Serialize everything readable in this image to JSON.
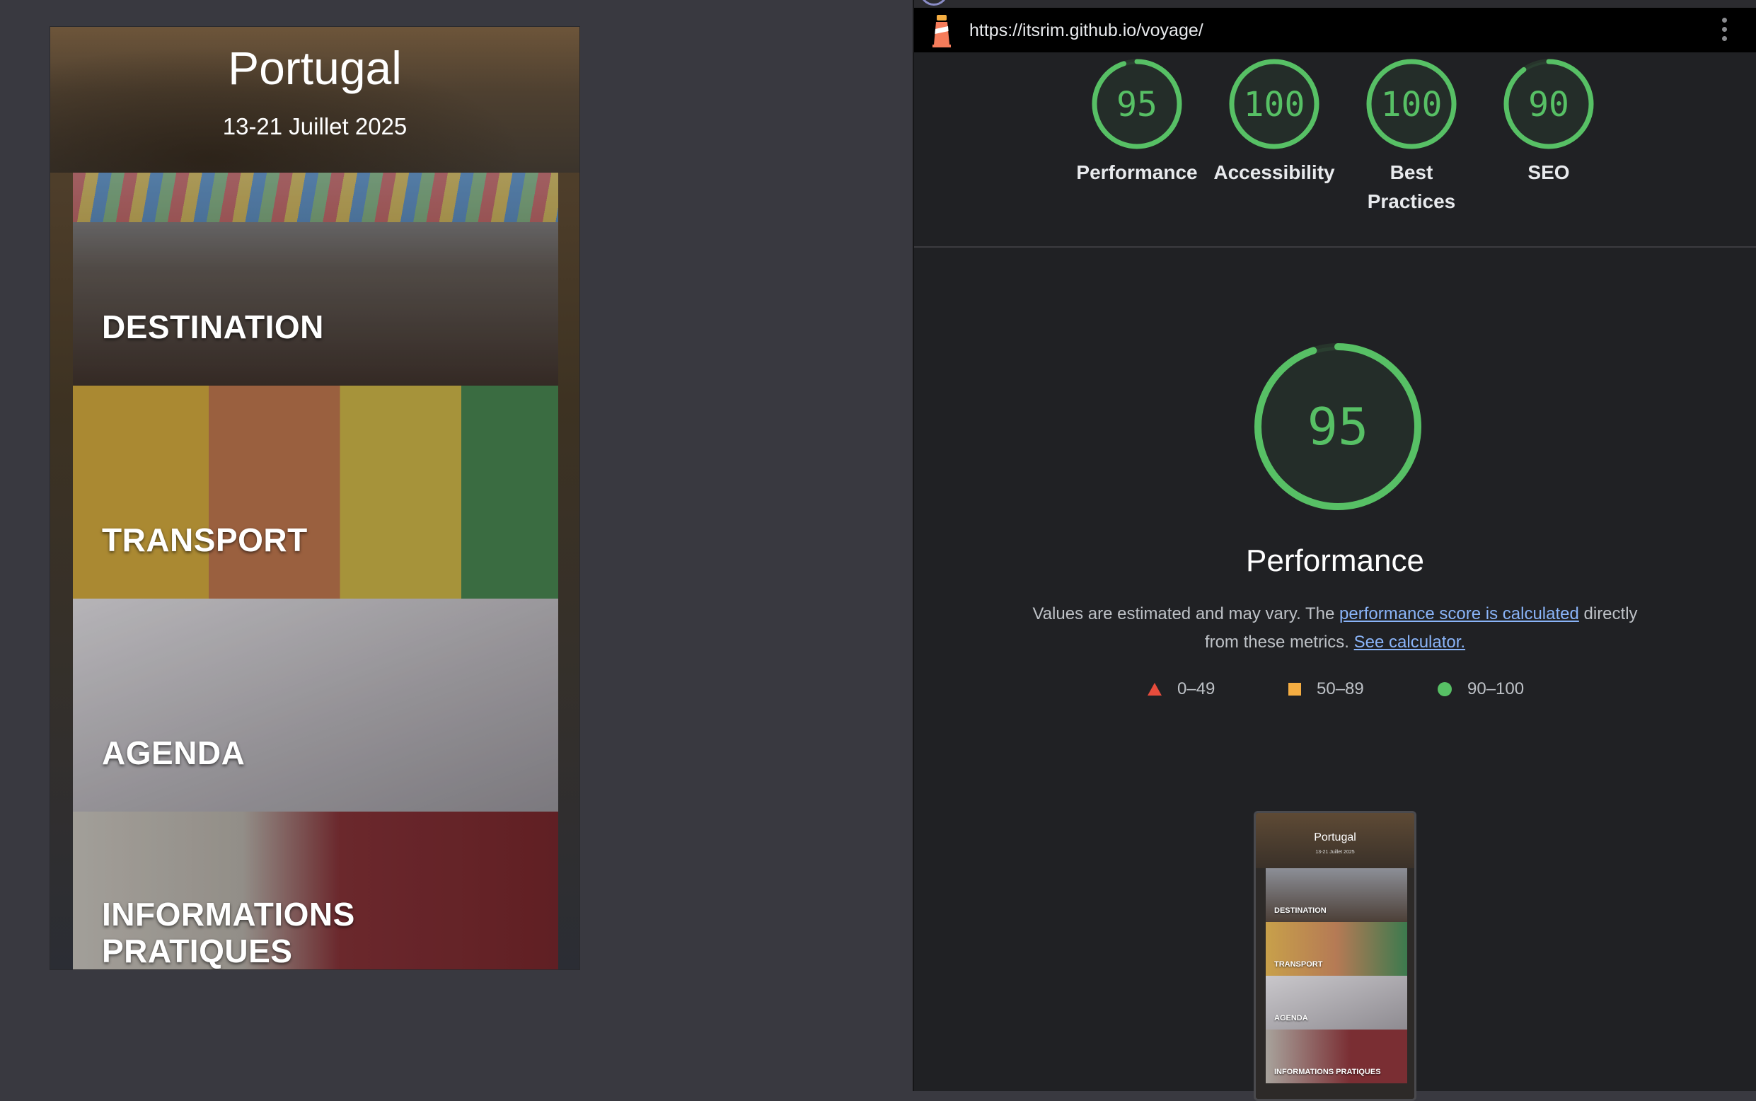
{
  "preview": {
    "title": "Portugal",
    "dates": "13-21 Juillet 2025",
    "cards": [
      {
        "label": "DESTINATION"
      },
      {
        "label": "TRANSPORT"
      },
      {
        "label": "AGENDA"
      },
      {
        "label": "INFORMATIONS PRATIQUES"
      }
    ]
  },
  "lighthouse": {
    "url": "https://itsrim.github.io/voyage/",
    "icons": {
      "app": "lighthouse-icon",
      "menu": "kebab-menu-icon"
    },
    "scores": [
      {
        "label": "Performance",
        "value": 95
      },
      {
        "label": "Accessibility",
        "value": 100
      },
      {
        "label": "Best Practices",
        "value": 100
      },
      {
        "label": "SEO",
        "value": 90
      }
    ],
    "main": {
      "score": 95,
      "title": "Performance",
      "desc_prefix": "Values are estimated and may vary. The ",
      "link_score": "performance score is calculated",
      "desc_middle": " directly from these metrics. ",
      "link_calc": "See calculator."
    },
    "legend": [
      {
        "label": "0–49",
        "shape": "triangle",
        "color": "#e74c3c"
      },
      {
        "label": "50–89",
        "shape": "square",
        "color": "#f4ad42"
      },
      {
        "label": "90–100",
        "shape": "circle",
        "color": "#57c065"
      }
    ],
    "thumbnail": {
      "title": "Portugal",
      "dates": "13-21 Juillet 2025",
      "cards": [
        "DESTINATION",
        "TRANSPORT",
        "AGENDA",
        "INFORMATIONS PRATIQUES"
      ]
    }
  },
  "colors": {
    "pass": "#57c065",
    "average": "#f4ad42",
    "fail": "#e74c3c",
    "link": "#8ab4f8",
    "panel_bg": "#202124"
  }
}
